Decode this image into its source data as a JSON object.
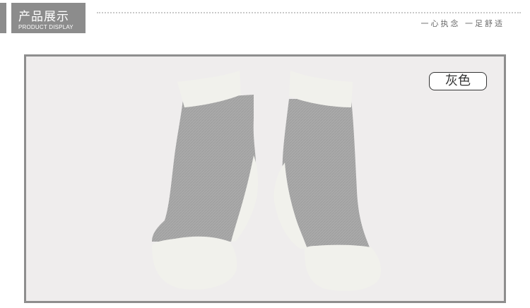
{
  "header": {
    "title": "产品展示",
    "subtitle": "PRODUCT DISPLAY",
    "slogan": "一心执念 一足舒适"
  },
  "product": {
    "color_tag": "灰色",
    "image_icon": "pair-of-gray-ankle-socks-image",
    "colors": {
      "sock_body": "#aaaaaa",
      "sock_trim": "#f1f1ec",
      "frame_border": "#8e8e8e",
      "header_bg": "#8c8c8c"
    }
  }
}
